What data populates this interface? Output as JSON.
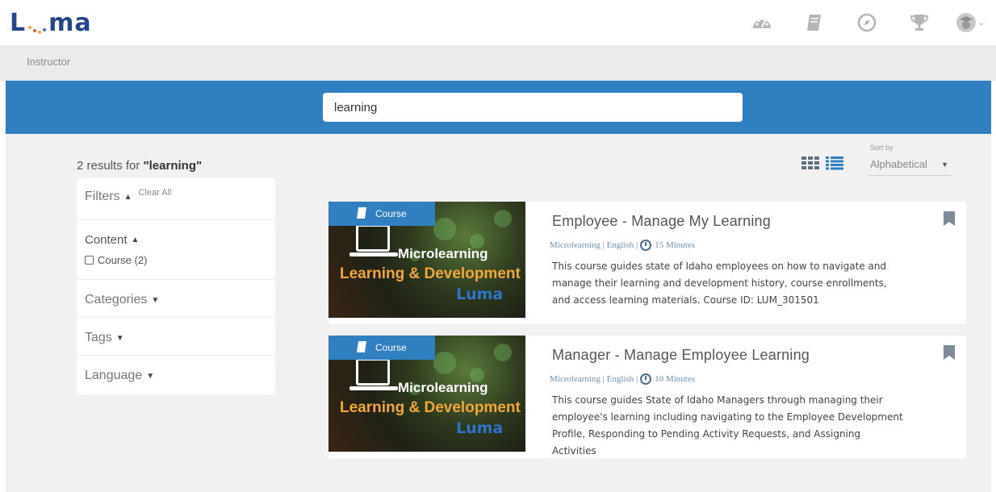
{
  "brand": {
    "logo_text_left": "L",
    "logo_text_right": "ma",
    "logo_dot_colors": [
      "#f2a73b",
      "#e8583a",
      "#f2a73b",
      "#2f7fc1"
    ]
  },
  "nav": {
    "icons": [
      "dashboard-icon",
      "catalog-book-icon",
      "explore-compass-icon",
      "achievements-trophy-icon",
      "profile-avatar-icon"
    ]
  },
  "breadcrumb": {
    "label": "Instructor"
  },
  "search": {
    "value": "learning"
  },
  "results": {
    "count_text": "2 results for ",
    "query_display": "\"learning\""
  },
  "view": {
    "grid_icon": "grid-view-icon",
    "list_icon": "list-view-icon"
  },
  "sort": {
    "label": "Sort by",
    "selected": "Alphabetical"
  },
  "filters": {
    "title": "Filters",
    "clear_all": "Clear All",
    "content": {
      "title": "Content",
      "options": [
        {
          "label": "Course (2)",
          "checked": false
        }
      ]
    },
    "categories": {
      "title": "Categories"
    },
    "tags": {
      "title": "Tags"
    },
    "language": {
      "title": "Language"
    }
  },
  "courses": [
    {
      "badge": "Course",
      "thumb_line1": "Microlearning",
      "thumb_line2": "Learning & Development",
      "thumb_brand": "Luma",
      "title": "Employee - Manage My Learning",
      "meta_prefix": "Microlearning | English |",
      "duration": "15 Minutes",
      "description": "This course guides state of Idaho employees on how to navigate and manage their learning and development history, course enrollments, and access learning materials.  Course ID: LUM_301501"
    },
    {
      "badge": "Course",
      "thumb_line1": "Microlearning",
      "thumb_line2": "Learning & Development",
      "thumb_brand": "Luma",
      "title": "Manager - Manage Employee Learning",
      "meta_prefix": "Microlearning | English |",
      "duration": "10 Minutes",
      "description": "This course guides State of Idaho Managers through managing their employee's learning including navigating to the Employee Development Profile, Responding to Pending Activity Requests, and Assigning Activities"
    }
  ],
  "colors": {
    "primary_blue": "#2f7fc1",
    "logo_navy": "#23468c",
    "thumb_orange": "#f2a73b"
  }
}
